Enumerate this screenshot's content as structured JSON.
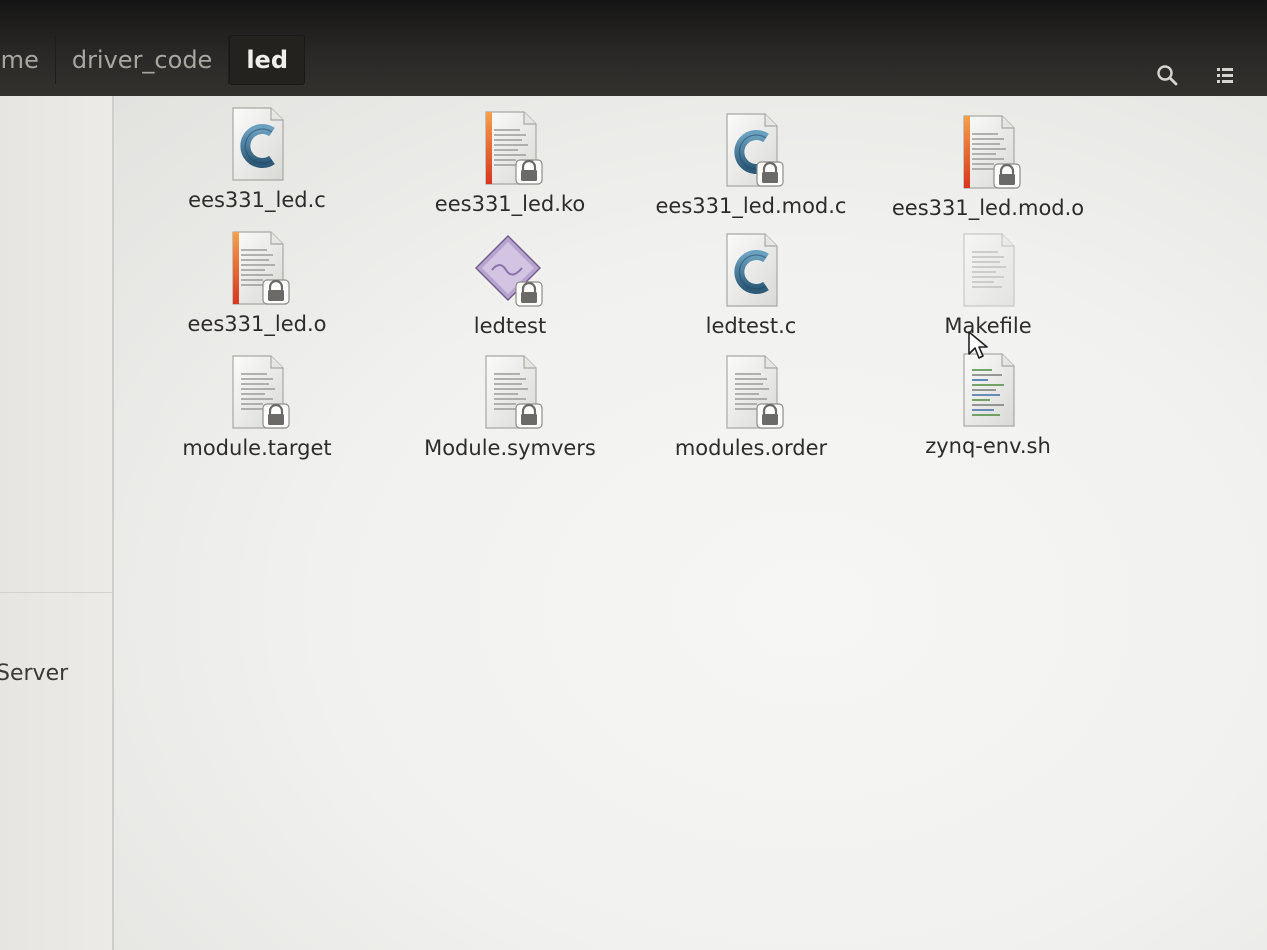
{
  "breadcrumbs": [
    "ome",
    "driver_code",
    "led"
  ],
  "sidebar": {
    "visible_label": "Server"
  },
  "files": [
    {
      "name": "ees331_led.c",
      "icon": "c-source-icon"
    },
    {
      "name": "ees331_led.ko",
      "icon": "locked-object-file-icon"
    },
    {
      "name": "ees331_led.mod.c",
      "icon": "locked-c-source-icon"
    },
    {
      "name": "ees331_led.mod.o",
      "icon": "locked-object-file-icon"
    },
    {
      "name": "ees331_led.o",
      "icon": "locked-object-file-icon"
    },
    {
      "name": "ledtest",
      "icon": "locked-executable-icon"
    },
    {
      "name": "ledtest.c",
      "icon": "c-source-icon"
    },
    {
      "name": "Makefile",
      "icon": "text-file-icon"
    },
    {
      "name": "module.target",
      "icon": "locked-text-file-icon"
    },
    {
      "name": "Module.symvers",
      "icon": "locked-text-file-icon"
    },
    {
      "name": "modules.order",
      "icon": "locked-text-file-icon"
    },
    {
      "name": "zynq-env.sh",
      "icon": "shell-script-icon"
    }
  ],
  "colors": {
    "header": "#2a2826",
    "accent_orange": "#e8572a",
    "c_icon_blue": "#3b6e8f"
  }
}
